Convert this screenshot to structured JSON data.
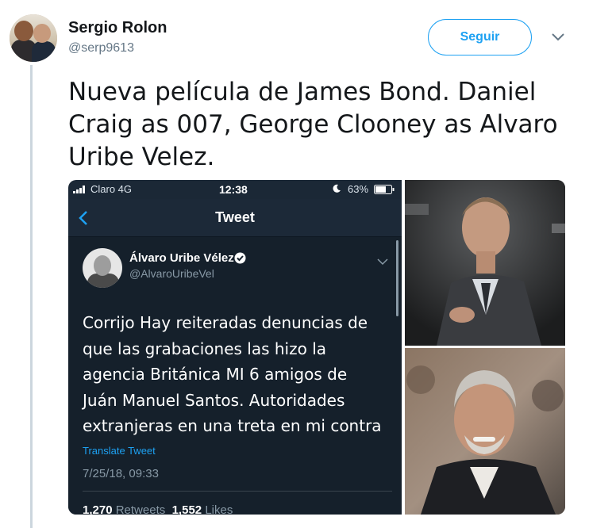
{
  "author": {
    "name": "Sergio Rolon",
    "handle": "@serp9613"
  },
  "actions": {
    "follow_label": "Seguir"
  },
  "tweet": {
    "text": "Nueva película de James Bond. Daniel Craig as 007, George Clooney as Alvaro Uribe Velez."
  },
  "screenshot": {
    "statusbar": {
      "carrier": "Claro  4G",
      "time": "12:38",
      "battery": "63%"
    },
    "nav_title": "Tweet",
    "quoted": {
      "name": "Álvaro Uribe Vélez",
      "handle": "@AlvaroUribeVel",
      "text": "Corrijo Hay reiteradas denuncias de que las grabaciones las hizo la agencia Británica MI 6 amigos de Juán Manuel Santos. Autoridades extranjeras en una treta en mi contra",
      "translate_label": "Translate Tweet",
      "date": "7/25/18, 09:33",
      "retweets_count": "1,270",
      "retweets_label": "Retweets",
      "likes_count": "1,552",
      "likes_label": "Likes"
    }
  },
  "colors": {
    "accent": "#1da1f2",
    "dark_bg": "#15202b",
    "thread_line": "#ccd6dd"
  },
  "icons": [
    "chevron-down-icon",
    "back-chevron-icon",
    "verified-badge-icon",
    "signal-icon",
    "moon-icon",
    "battery-icon"
  ]
}
